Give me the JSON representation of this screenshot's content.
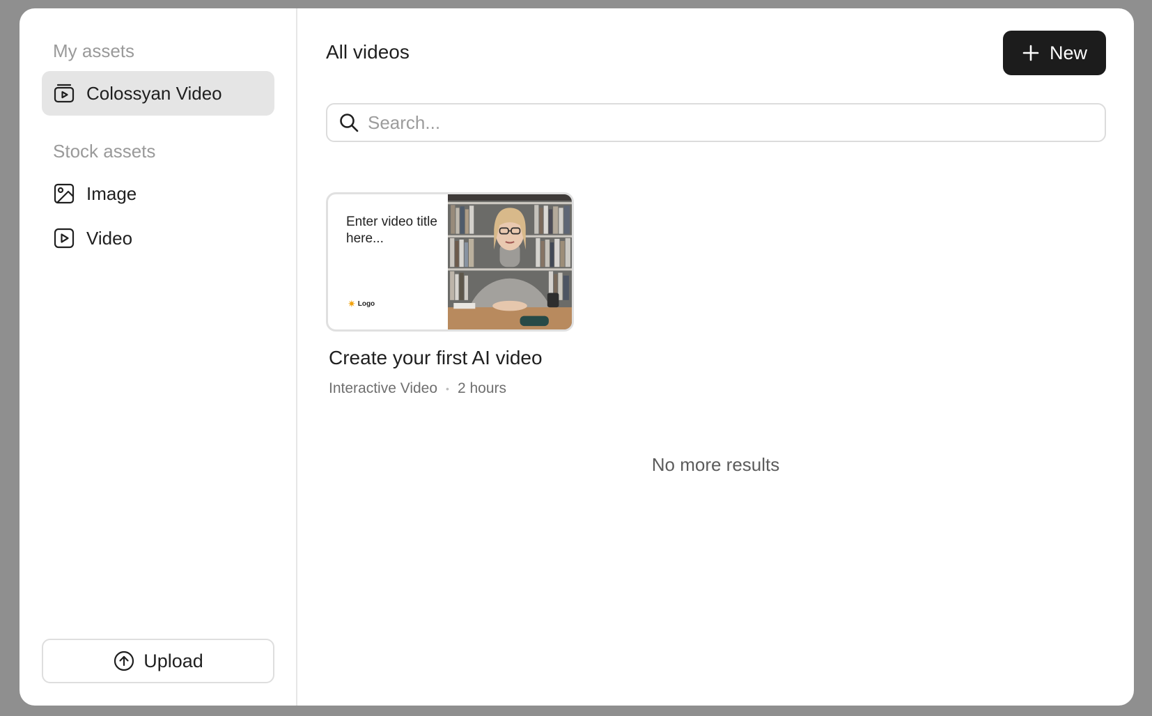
{
  "sidebar": {
    "my_assets_label": "My assets",
    "my_items": [
      {
        "label": "Colossyan Video",
        "icon": "video-library-icon",
        "active": true
      }
    ],
    "stock_assets_label": "Stock assets",
    "stock_items": [
      {
        "label": "Image",
        "icon": "image-icon"
      },
      {
        "label": "Video",
        "icon": "play-square-icon"
      }
    ],
    "upload_label": "Upload"
  },
  "main": {
    "title": "All videos",
    "new_label": "New",
    "search_placeholder": "Search...",
    "cards": [
      {
        "thumb_title": "Enter video title here...",
        "thumb_logo": "Logo",
        "title": "Create your first AI video",
        "type": "Interactive Video",
        "age": "2 hours"
      }
    ],
    "no_more": "No more results"
  },
  "colors": {
    "primary_button": "#1c1c1c",
    "active_item_bg": "#e5e5e5",
    "logo_accent": "#f2a20c"
  }
}
